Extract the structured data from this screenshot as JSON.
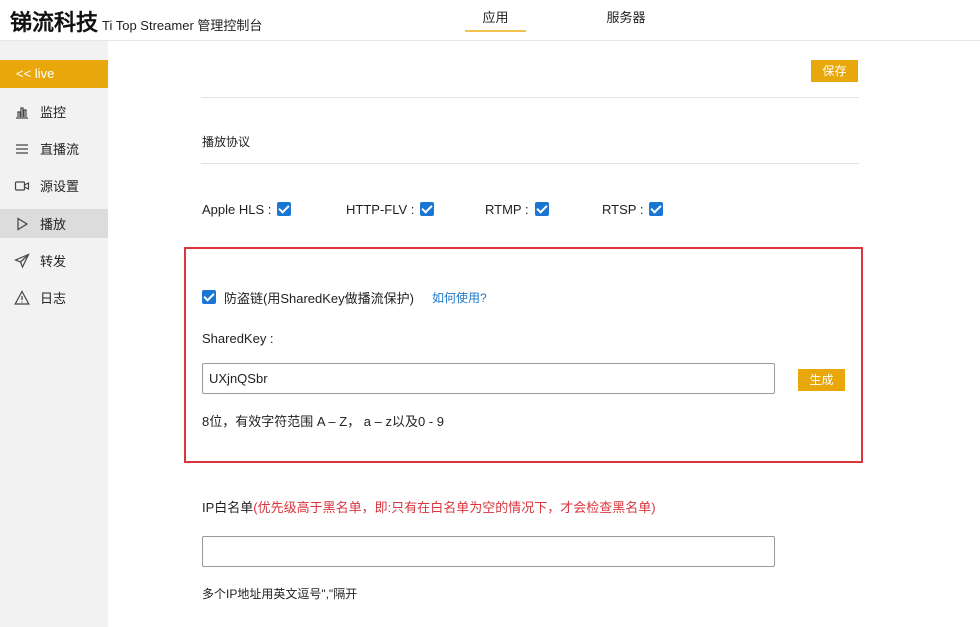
{
  "header": {
    "brand": "锑流科技",
    "subtitle": "Ti Top Streamer 管理控制台",
    "tabs": [
      {
        "label": "应用",
        "active": true
      },
      {
        "label": "服务器",
        "active": false
      }
    ]
  },
  "sidebar": {
    "live_label": "<<  live",
    "items": [
      {
        "label": "监控",
        "icon": "bar-chart-icon"
      },
      {
        "label": "直播流",
        "icon": "list-icon"
      },
      {
        "label": "源设置",
        "icon": "video-camera-icon"
      },
      {
        "label": "播放",
        "icon": "play-icon",
        "active": true
      },
      {
        "label": "转发",
        "icon": "send-icon"
      },
      {
        "label": "日志",
        "icon": "warning-icon"
      }
    ]
  },
  "main": {
    "save_label": "保存",
    "section_title": "播放协议",
    "protocols": [
      {
        "label": "Apple HLS :",
        "checked": true
      },
      {
        "label": "HTTP-FLV :",
        "checked": true
      },
      {
        "label": "RTMP :",
        "checked": true
      },
      {
        "label": "RTSP :",
        "checked": true
      }
    ],
    "anti_leech": {
      "label": "防盗链(用SharedKey做播流保护)",
      "checked": true,
      "help_link": "如何使用?",
      "shared_key_label": "SharedKey :",
      "shared_key_value": "UXjnQSbr",
      "generate_label": "生成",
      "hint": "8位，有效字符范围 A – Z， a – z以及0 - 9"
    },
    "ip_whitelist": {
      "label": "IP白名单",
      "note": "(优先级高于黑名单，即:只有在白名单为空的情况下，才会检查黑名单)",
      "value": "",
      "hint": "多个IP地址用英文逗号\",\"隔开"
    }
  },
  "colors": {
    "accent": "#e8a80c",
    "checkbox": "#1976d2",
    "highlight_border": "#d9363e",
    "link": "#1e78c8"
  }
}
